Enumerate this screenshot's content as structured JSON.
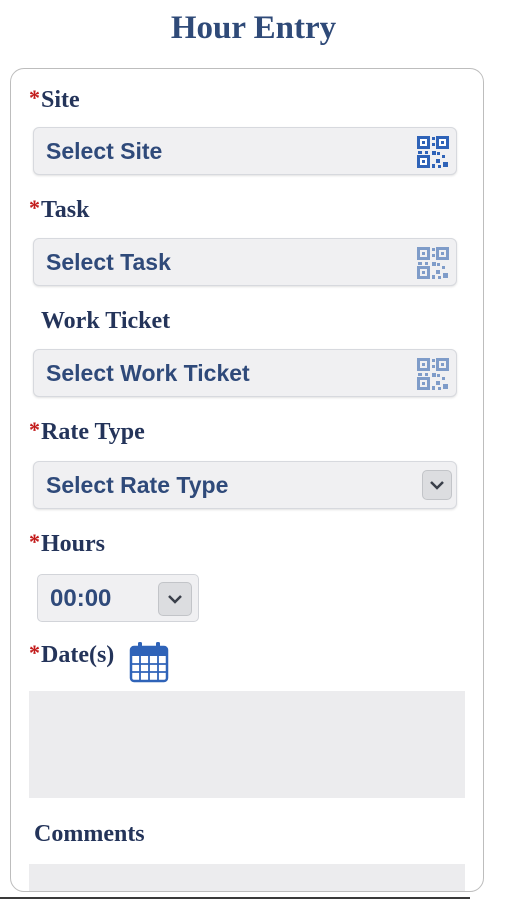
{
  "page": {
    "title": "Hour Entry"
  },
  "form": {
    "required_mark": "*",
    "site": {
      "label": "Site",
      "value": "Select Site",
      "icon": "qr-code-icon"
    },
    "task": {
      "label": "Task",
      "value": "Select Task",
      "icon": "qr-code-icon"
    },
    "work_ticket": {
      "label": "Work Ticket",
      "value": "Select Work Ticket",
      "icon": "qr-code-icon"
    },
    "rate_type": {
      "label": "Rate Type",
      "value": "Select Rate Type",
      "icon": "chevron-down-icon"
    },
    "hours": {
      "label": "Hours",
      "value": "00:00",
      "icon": "chevron-down-icon"
    },
    "dates": {
      "label": "Date(s)",
      "icon": "calendar-icon"
    },
    "comments": {
      "label": "Comments"
    }
  },
  "colors": {
    "label": "#24345a",
    "required": "#c21a1a",
    "field_text": "#2f4a7a",
    "qr_active": "#2f63b8",
    "qr_inactive": "#7f9cc9"
  }
}
